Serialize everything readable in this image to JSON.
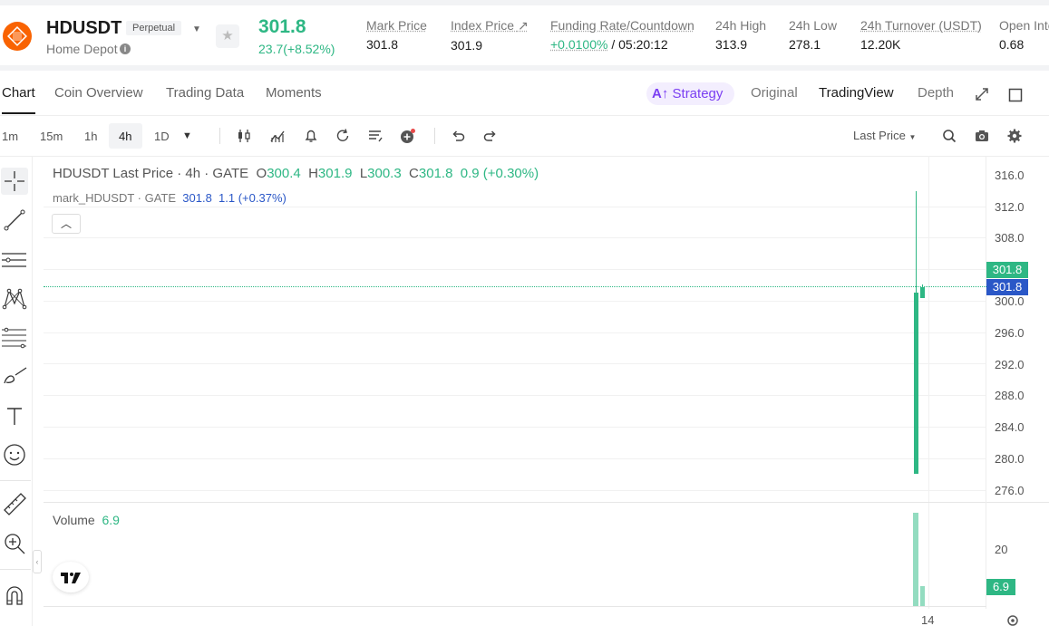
{
  "header": {
    "symbol": "HDUSDT",
    "contract_type": "Perpetual",
    "company": "Home Depot",
    "last_price": "301.8",
    "change": "23.7(+8.52%)",
    "stats": {
      "mark_price_label": "Mark Price",
      "mark_price": "301.8",
      "index_price_label": "Index Price",
      "index_price": "301.9",
      "funding_label": "Funding Rate/Countdown",
      "funding_rate": "+0.0100%",
      "countdown": "/ 05:20:12",
      "high_label": "24h High",
      "high": "313.9",
      "low_label": "24h Low",
      "low": "278.1",
      "turnover_label": "24h Turnover (USDT)",
      "turnover": "12.20K",
      "open_interest_label": "Open Inte",
      "open_interest": "0.68"
    }
  },
  "tabs": {
    "chart": "Chart",
    "coin_overview": "Coin Overview",
    "trading_data": "Trading Data",
    "moments": "Moments",
    "strategy": "Strategy",
    "original": "Original",
    "tradingview": "TradingView",
    "depth": "Depth"
  },
  "toolbar": {
    "timeframes": [
      "1m",
      "15m",
      "1h",
      "4h",
      "1D"
    ],
    "active_timeframe": "4h",
    "price_type": "Last Price"
  },
  "chart": {
    "legend_main": {
      "title": "HDUSDT Last Price · 4h · GATE",
      "o_label": "O",
      "o": "300.4",
      "h_label": "H",
      "h": "301.9",
      "l_label": "L",
      "l": "300.3",
      "c_label": "C",
      "c": "301.8",
      "change": "0.9 (+0.30%)"
    },
    "legend_mark": {
      "title": "mark_HDUSDT · GATE",
      "value": "301.8",
      "change": "1.1 (+0.37%)"
    },
    "y_axis": [
      "316.0",
      "312.0",
      "308.0",
      "300.0",
      "296.0",
      "292.0",
      "288.0",
      "284.0",
      "280.0",
      "276.0"
    ],
    "last_price_tag": "301.8",
    "mark_price_tag": "301.8",
    "volume_label": "Volume",
    "volume_value": "6.9",
    "volume_axis": "20",
    "volume_tag": "6.9",
    "x_axis_label": "14"
  },
  "colors": {
    "up": "#2eb784",
    "mark_blue": "#2a57c7",
    "strategy_purple": "#7b3ff2",
    "logo_orange": "#f96302"
  }
}
